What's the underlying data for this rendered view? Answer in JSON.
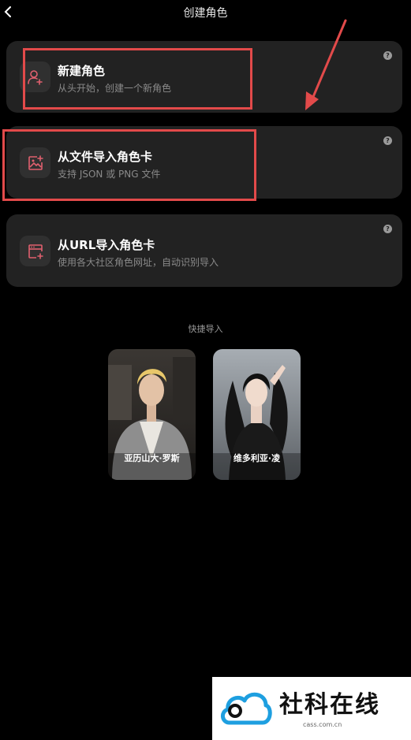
{
  "header": {
    "title": "创建角色",
    "back_icon": "chevron-left-icon"
  },
  "options": [
    {
      "title": "新建角色",
      "subtitle": "从头开始，创建一个新角色",
      "icon": "user-plus-icon",
      "help": "?"
    },
    {
      "title": "从文件导入角色卡",
      "subtitle": "支持 JSON 或 PNG 文件",
      "icon": "image-plus-icon",
      "help": "?"
    },
    {
      "title": "从URL导入角色卡",
      "subtitle": "使用各大社区角色网址，自动识别导入",
      "icon": "browser-plus-icon",
      "help": "?"
    }
  ],
  "quick_import": {
    "label": "快捷导入",
    "characters": [
      {
        "name": "亚历山大·罗斯"
      },
      {
        "name": "维多利亚·凌"
      }
    ]
  },
  "watermark": {
    "text": "社科在线",
    "url": "cass.com.cn"
  },
  "colors": {
    "background": "#000000",
    "card": "#222222",
    "accent_icon": "#e0606e",
    "annotation": "#e24a4a"
  }
}
